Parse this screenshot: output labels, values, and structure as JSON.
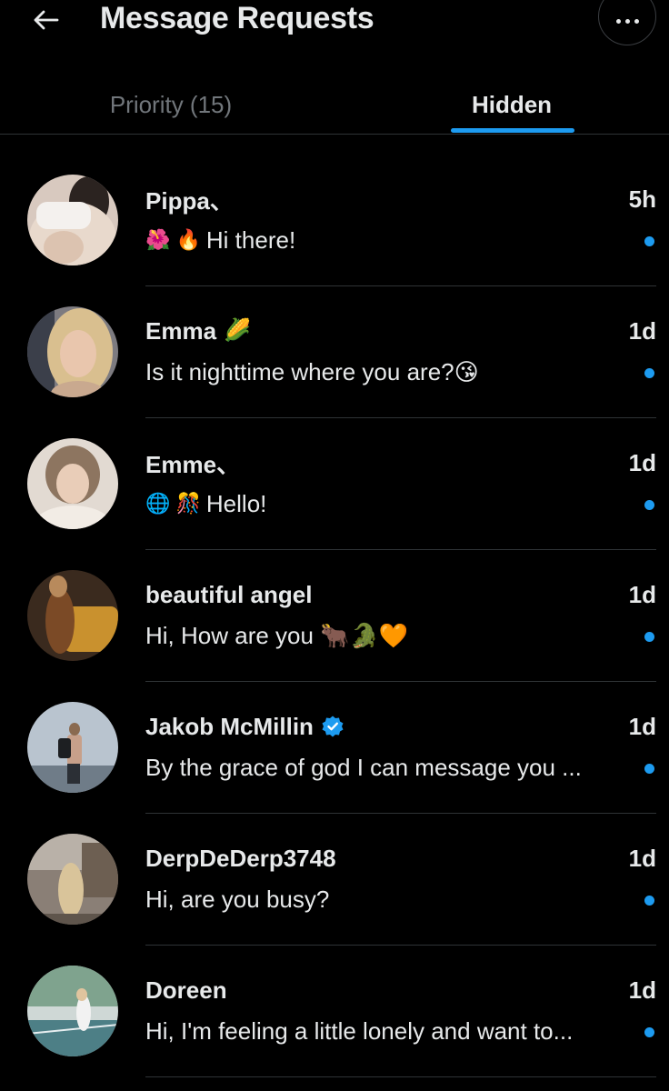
{
  "header": {
    "title": "Message Requests",
    "back_icon": "arrow-left-icon",
    "more_icon": "more-dots-icon"
  },
  "tabs": [
    {
      "label": "Priority (15)",
      "active": false
    },
    {
      "label": "Hidden",
      "active": true
    }
  ],
  "colors": {
    "background": "#000000",
    "accent": "#1d9bf0",
    "text_primary": "#e7e9ea",
    "text_secondary": "#71767b",
    "divider": "#2f3336"
  },
  "conversations": [
    {
      "name": "Pippa、",
      "name_emoji": "",
      "verified": false,
      "time": "5h",
      "preview_emoji": "🌺 🔥",
      "preview": "Hi there!",
      "unread": true
    },
    {
      "name": "Emma",
      "name_emoji": "🌽",
      "verified": false,
      "time": "1d",
      "preview_emoji": "",
      "preview": "Is it nighttime where you are?😘",
      "unread": true
    },
    {
      "name": "Emme、",
      "name_emoji": "",
      "verified": false,
      "time": "1d",
      "preview_emoji": "🌐 🎊",
      "preview": "Hello!",
      "unread": true
    },
    {
      "name": "beautiful angel",
      "name_emoji": "",
      "verified": false,
      "time": "1d",
      "preview_emoji": "",
      "preview": "Hi, How are you 🐂🐊🧡",
      "unread": true
    },
    {
      "name": "Jakob McMillin",
      "name_emoji": "",
      "verified": true,
      "time": "1d",
      "preview_emoji": "",
      "preview": "By the grace of god I can message you ...",
      "unread": true
    },
    {
      "name": "DerpDeDerp3748",
      "name_emoji": "",
      "verified": false,
      "time": "1d",
      "preview_emoji": "",
      "preview": "Hi, are you busy?",
      "unread": true
    },
    {
      "name": "Doreen",
      "name_emoji": "",
      "verified": false,
      "time": "1d",
      "preview_emoji": "",
      "preview": "Hi, I'm feeling a little lonely and want to...",
      "unread": true
    }
  ]
}
